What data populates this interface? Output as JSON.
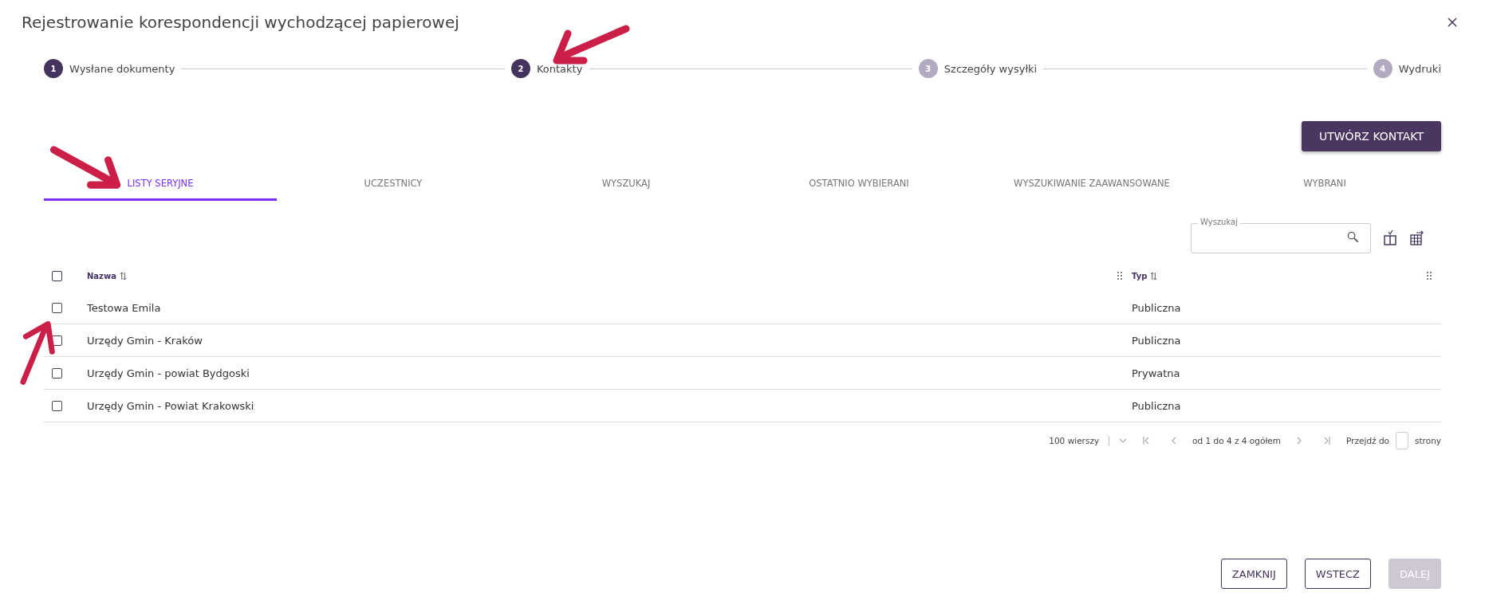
{
  "window": {
    "title": "Rejestrowanie korespondencji wychodzącej papierowej"
  },
  "steps": [
    {
      "number": "1",
      "label": "Wysłane dokumenty",
      "reached": true
    },
    {
      "number": "2",
      "label": "Kontakty",
      "reached": true
    },
    {
      "number": "3",
      "label": "Szczegóły wysyłki",
      "reached": false
    },
    {
      "number": "4",
      "label": "Wydruki",
      "reached": false
    }
  ],
  "create_button": "UTWÓRZ KONTAKT",
  "tabs": [
    {
      "label": "LISTY SERYJNE",
      "selected": true
    },
    {
      "label": "UCZESTNICY",
      "selected": false
    },
    {
      "label": "WYSZUKAJ",
      "selected": false
    },
    {
      "label": "OSTATNIO WYBIERANI",
      "selected": false
    },
    {
      "label": "WYSZUKIWANIE ZAAWANSOWANE",
      "selected": false
    },
    {
      "label": "WYBRANI",
      "selected": false
    }
  ],
  "search": {
    "label": "Wyszukaj"
  },
  "table": {
    "select_all_checked": false,
    "columns": [
      "Nazwa",
      "Typ"
    ],
    "rows": [
      {
        "checked": false,
        "cells": [
          "Testowa Emila",
          "Publiczna"
        ]
      },
      {
        "checked": false,
        "cells": [
          "Urzędy Gmin - Kraków",
          "Publiczna"
        ]
      },
      {
        "checked": false,
        "cells": [
          "Urzędy Gmin - powiat Bydgoski",
          "Prywatna"
        ]
      },
      {
        "checked": false,
        "cells": [
          "Urzędy Gmin - Powiat Krakowski",
          "Publiczna"
        ]
      }
    ]
  },
  "pagination": {
    "rows_per_page": "100 wierszy",
    "range": "od 1 do 4 z 4 ogółem",
    "goto_label": "Przejdź do",
    "goto_suffix": "strony"
  },
  "buttons": [
    {
      "label": "ZAMKNIJ",
      "disabled": false
    },
    {
      "label": "WSTECZ",
      "disabled": false
    },
    {
      "label": "DALEJ",
      "disabled": true
    }
  ]
}
